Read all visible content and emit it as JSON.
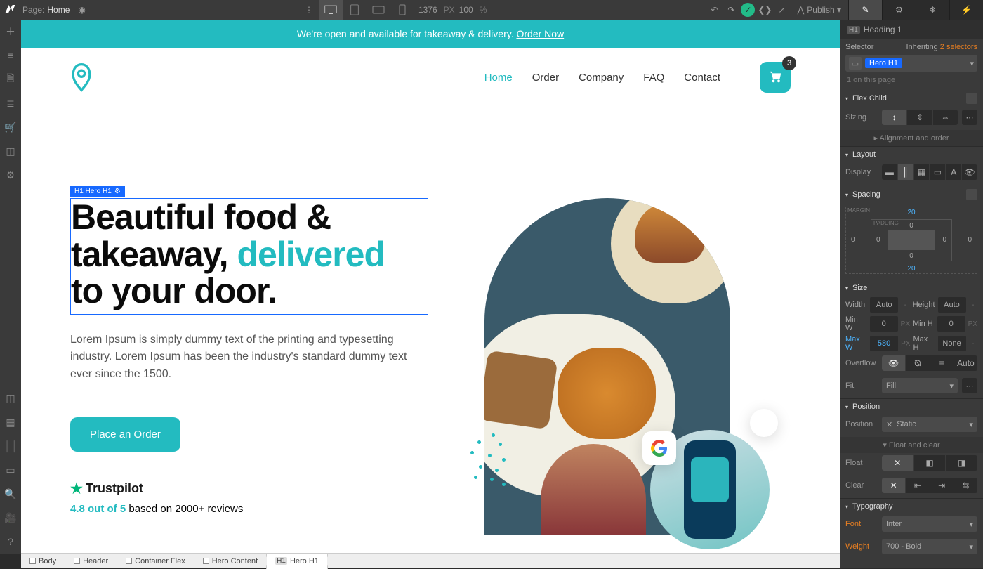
{
  "topbar": {
    "page_label": "Page:",
    "page_name": "Home",
    "canvas_width": "1376",
    "canvas_unit": "PX",
    "zoom": "100",
    "zoom_unit": "%",
    "publish": "Publish"
  },
  "canvas": {
    "announcement_text": "We're open and available for takeaway & delivery. ",
    "announcement_link": "Order Now",
    "nav": {
      "home": "Home",
      "order": "Order",
      "company": "Company",
      "faq": "FAQ",
      "contact": "Contact",
      "cart_count": "3"
    },
    "hero": {
      "tag": "H1  Hero H1",
      "title_line1": "Beautiful food & takeaway, ",
      "title_accent": "delivered",
      "title_line2": " to your door.",
      "paragraph": "Lorem Ipsum is simply dummy text of the printing and typesetting industry. Lorem Ipsum has been the industry's standard dummy text ever since the 1500.",
      "cta": "Place an Order",
      "trustpilot": "Trustpilot",
      "score": "4.8 out of 5",
      "score_text": " based on 2000+ reviews"
    }
  },
  "crumbs": [
    "Body",
    "Header",
    "Container Flex",
    "Hero Content",
    "Hero H1"
  ],
  "rpanel": {
    "elem_prefix": "H1",
    "elem_name": "Heading 1",
    "selector_label": "Selector",
    "inheriting": "Inheriting ",
    "inheriting_count": "2 selectors",
    "selector_chip": "Hero H1",
    "page_count": "1 on this page",
    "flexchild_hdr": "Flex Child",
    "sizing_label": "Sizing",
    "align_text": "Alignment and order",
    "layout_hdr": "Layout",
    "display_label": "Display",
    "spacing_hdr": "Spacing",
    "spacing": {
      "margin_label": "MARGIN",
      "padding_label": "PADDING",
      "m_top": "20",
      "m_right": "0",
      "m_bottom": "20",
      "m_left": "0",
      "p_top": "0",
      "p_right": "0",
      "p_bottom": "0",
      "p_left": "0"
    },
    "size_hdr": "Size",
    "size": {
      "width_l": "Width",
      "width_v": "Auto",
      "width_u": "-",
      "height_l": "Height",
      "height_v": "Auto",
      "height_u": "-",
      "minw_l": "Min W",
      "minw_v": "0",
      "minw_u": "PX",
      "minh_l": "Min H",
      "minh_v": "0",
      "minh_u": "PX",
      "maxw_l": "Max W",
      "maxw_v": "580",
      "maxw_u": "PX",
      "maxh_l": "Max H",
      "maxh_v": "None",
      "maxh_u": "-",
      "overflow_l": "Overflow",
      "overflow_auto": "Auto",
      "fit_l": "Fit",
      "fit_v": "Fill"
    },
    "position_hdr": "Position",
    "position_l": "Position",
    "position_v": "Static",
    "floatclear": "Float and clear",
    "float_l": "Float",
    "clear_l": "Clear",
    "typo_hdr": "Typography",
    "font_l": "Font",
    "font_v": "Inter",
    "weight_l": "Weight",
    "weight_v": "700 - Bold"
  }
}
